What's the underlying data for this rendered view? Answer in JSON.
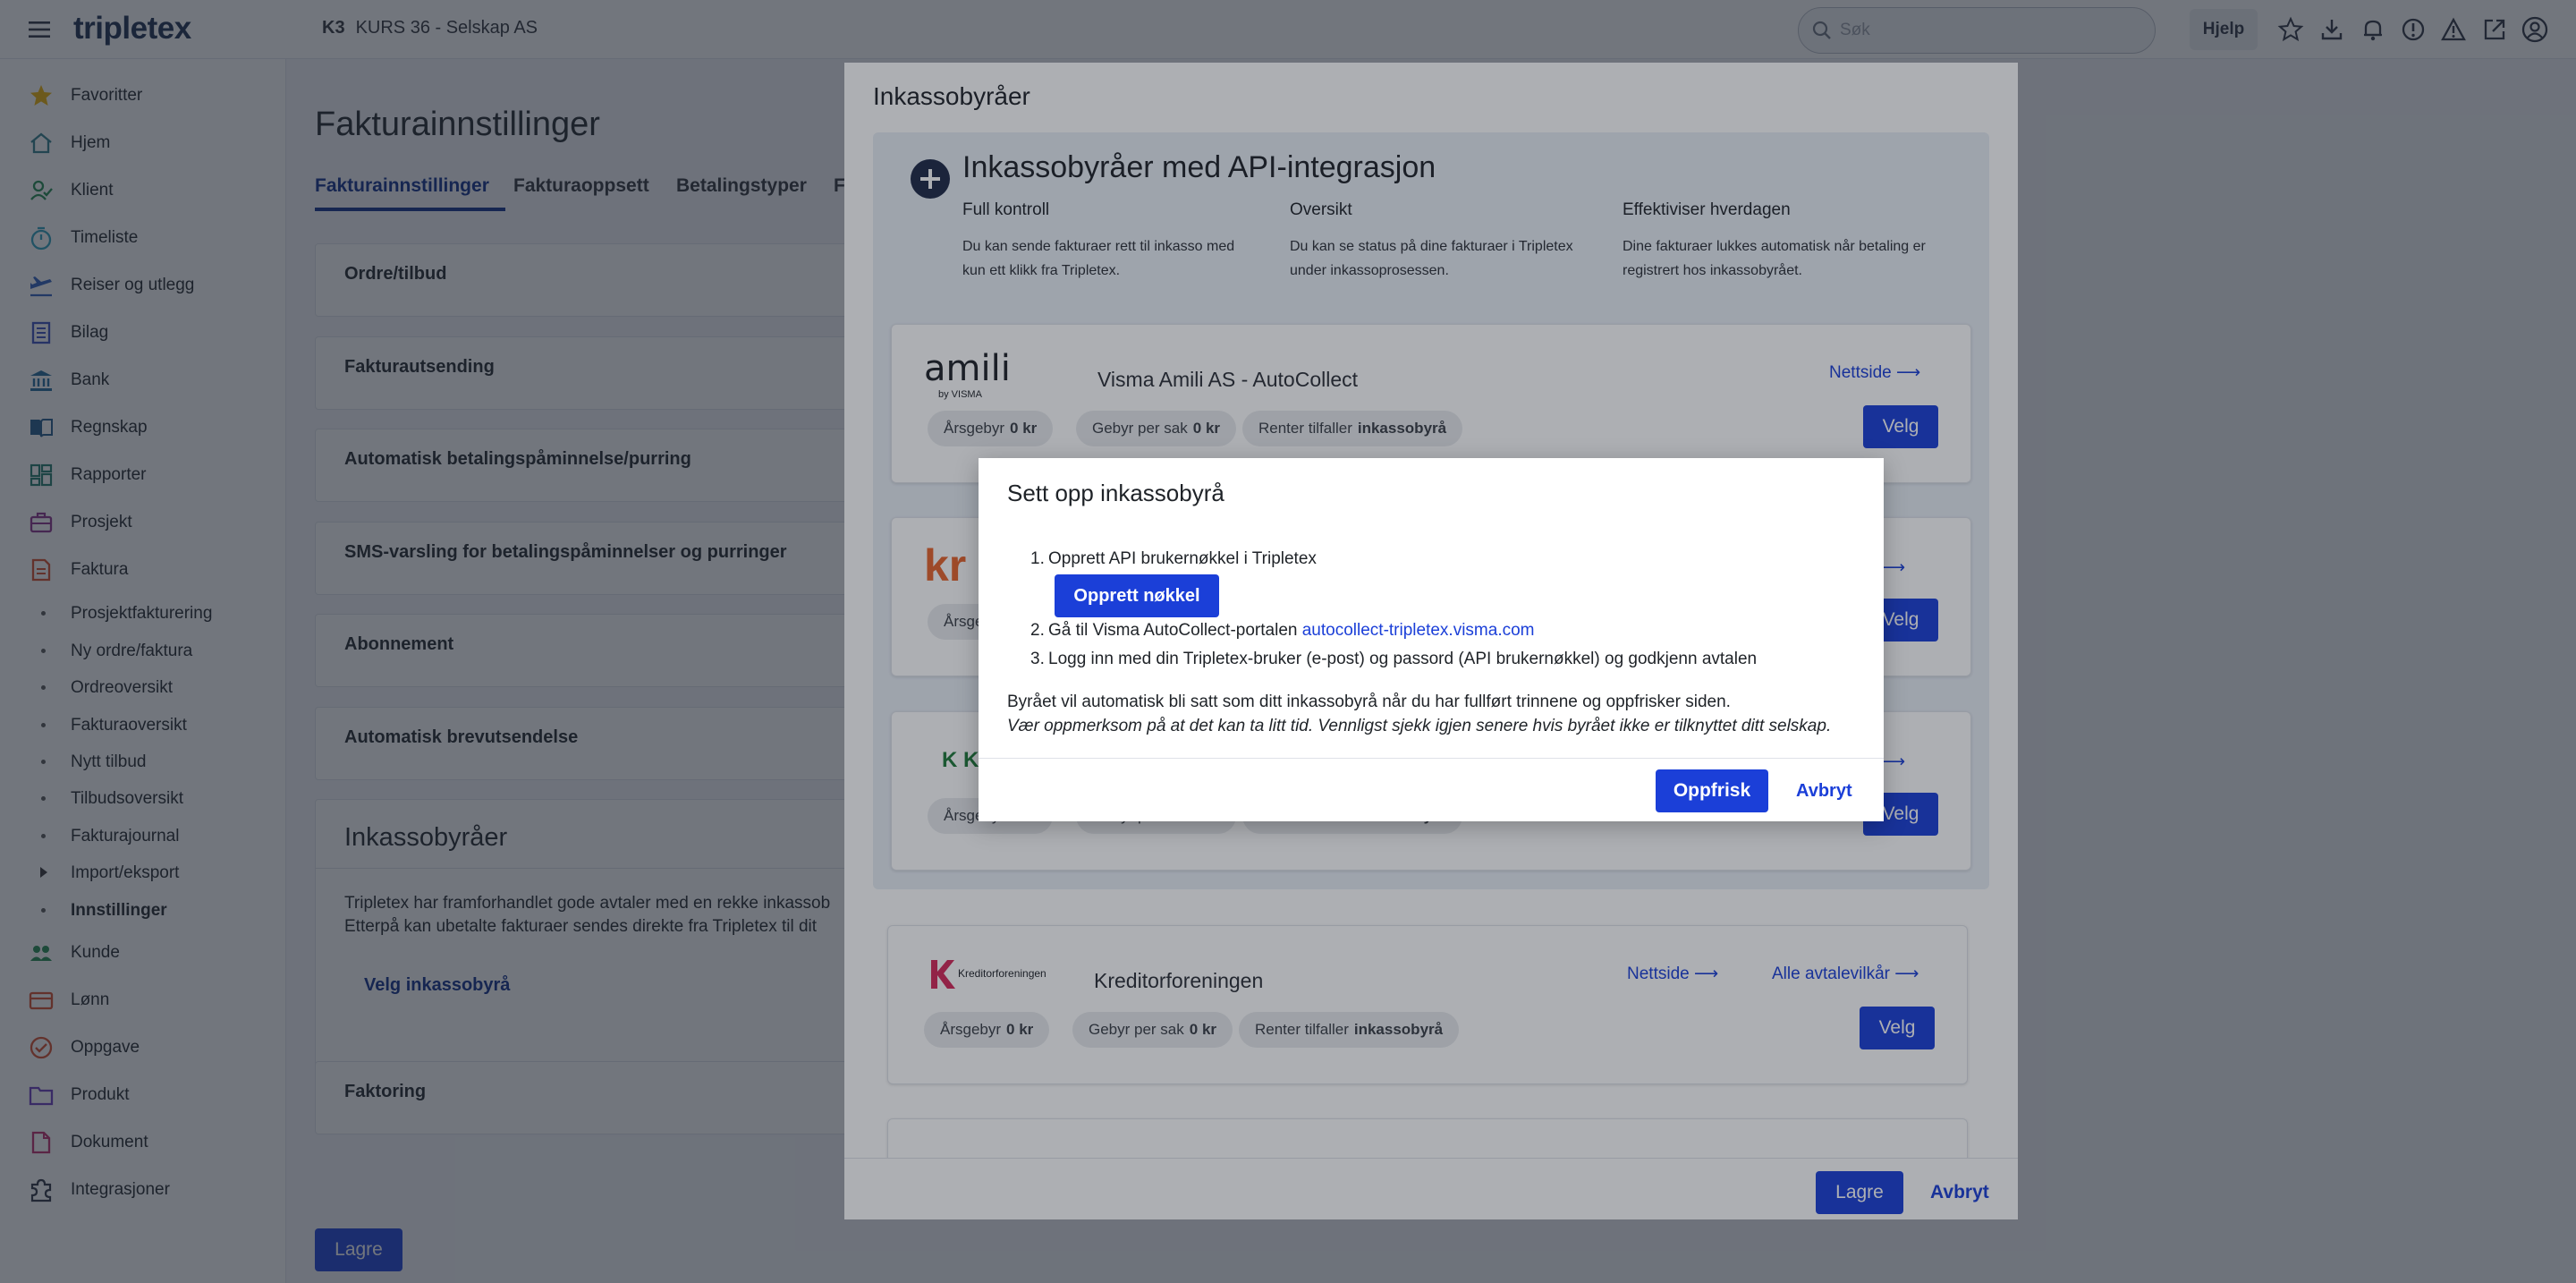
{
  "topbar": {
    "brand": "tripletex",
    "company_code": "K3",
    "company_name": "KURS 36 - Selskap AS",
    "search_placeholder": "Søk",
    "help_label": "Hjelp"
  },
  "sidebar": {
    "items": [
      {
        "label": "Favoritter",
        "icon": "star-icon"
      },
      {
        "label": "Hjem",
        "icon": "home-icon"
      },
      {
        "label": "Klient",
        "icon": "client-icon"
      },
      {
        "label": "Timeliste",
        "icon": "timer-icon"
      },
      {
        "label": "Reiser og utlegg",
        "icon": "plane-icon"
      },
      {
        "label": "Bilag",
        "icon": "voucher-icon"
      },
      {
        "label": "Bank",
        "icon": "bank-icon"
      },
      {
        "label": "Regnskap",
        "icon": "book-icon"
      },
      {
        "label": "Rapporter",
        "icon": "dashboard-icon"
      },
      {
        "label": "Prosjekt",
        "icon": "briefcase-icon"
      },
      {
        "label": "Faktura",
        "icon": "invoice-icon"
      }
    ],
    "faktura_sub": [
      "Prosjektfakturering",
      "Ny ordre/faktura",
      "Ordreoversikt",
      "Fakturaoversikt",
      "Nytt tilbud",
      "Tilbudsoversikt",
      "Fakturajournal",
      "Import/eksport",
      "Innstillinger"
    ],
    "items_after": [
      {
        "label": "Kunde",
        "icon": "customers-icon"
      },
      {
        "label": "Lønn",
        "icon": "wallet-icon"
      },
      {
        "label": "Oppgave",
        "icon": "task-icon"
      },
      {
        "label": "Produkt",
        "icon": "folder-icon"
      },
      {
        "label": "Dokument",
        "icon": "document-icon"
      },
      {
        "label": "Integrasjoner",
        "icon": "puzzle-icon"
      }
    ]
  },
  "main": {
    "title": "Fakturainnstillinger",
    "tabs": [
      "Fakturainnstillinger",
      "Fakturaoppsett",
      "Betalingstyper",
      "F"
    ],
    "sections": [
      "Ordre/tilbud",
      "Fakturautsending",
      "Automatisk betalingspåminnelse/purring",
      "SMS-varsling for betalingspåminnelser og purringer",
      "Abonnement",
      "Automatisk brevutsendelse"
    ],
    "inkasso": {
      "title": "Inkassobyråer",
      "line1": "Tripletex har framforhandlet gode avtaler med en rekke inkassob",
      "line2": "Etterpå kan ubetalte fakturaer sendes direkte fra Tripletex til dit",
      "link": "Velg inkassobyrå"
    },
    "faktoring": "Faktoring",
    "save_label": "Lagre"
  },
  "dialog1": {
    "title": "Inkassobyråer",
    "api_title": "Inkassobyråer med API-integrasjon",
    "features": [
      {
        "heading": "Full kontroll",
        "text": "Du kan sende fakturaer rett til inkasso med kun ett klikk fra Tripletex."
      },
      {
        "heading": "Oversikt",
        "text": "Du kan se status på dine fakturaer i Tripletex under inkassoprosessen."
      },
      {
        "heading": "Effektiviser hverdagen",
        "text": "Dine fakturaer lukkes automatisk når betaling er registrert hos inkassobyrået."
      }
    ],
    "providers": [
      {
        "logo": "amili",
        "logo_sub": "by VISMA",
        "name": "Visma Amili AS - AutoCollect",
        "nettside": "Nettside ⟶"
      },
      {
        "logo": "kr",
        "name": "",
        "nettside": "e ⟶"
      },
      {
        "logo": "K Kr",
        "name": "",
        "nettside": "e ⟶"
      },
      {
        "logo": "Kreditorforeningen",
        "name": "Kreditorforeningen",
        "nettside": "Nettside ⟶",
        "terms": "Alle avtalevilkår ⟶"
      }
    ],
    "pills": {
      "arsgebyr": "Årsgebyr",
      "arsgebyr_val": "0 kr",
      "gebyr": "Gebyr per sak",
      "gebyr_val": "0 kr",
      "renter": "Renter tilfaller",
      "renter_val": "inkassobyrå"
    },
    "velg_label": "Velg",
    "save_label": "Lagre",
    "cancel_label": "Avbryt"
  },
  "dialog2": {
    "title": "Sett opp inkassobyrå",
    "step1": "Opprett API brukernøkkel i Tripletex",
    "create_key_label": "Opprett nøkkel",
    "step2_text": "Gå til Visma AutoCollect-portalen ",
    "step2_link": "autocollect-tripletex.visma.com",
    "step3": "Logg inn med din Tripletex-bruker (e-post) og passord (API brukernøkkel) og godkjenn avtalen",
    "info": "Byrået vil automatisk bli satt som ditt inkassobyrå når du har fullført trinnene og oppfrisker siden.",
    "warning": "Vær oppmerksom på at det kan ta litt tid. Vennligst sjekk igjen senere hvis byrået ikke er tilknyttet ditt selskap.",
    "refresh_label": "Oppfrisk",
    "cancel_label": "Avbryt"
  },
  "colors": {
    "accent": "#1b3fd8",
    "brand_navy": "#1a2b4c",
    "kreditor_red": "#d6285a",
    "kr_orange": "#e8642c",
    "k_green": "#1f7a3a"
  }
}
